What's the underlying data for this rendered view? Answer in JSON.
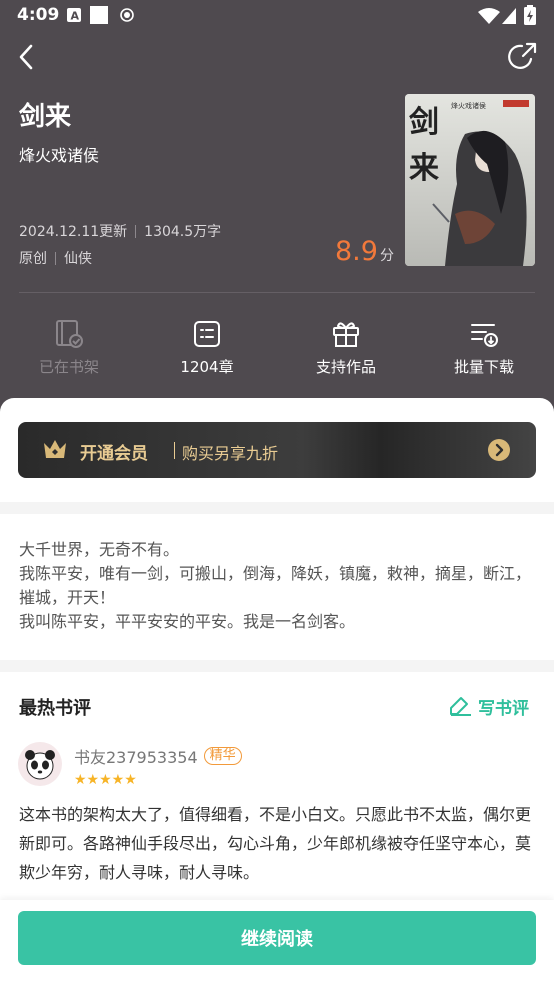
{
  "status_bar": {
    "time": "4:09"
  },
  "book": {
    "title": "剑来",
    "author": "烽火戏诸侯",
    "updated": "2024.12.11更新",
    "word_count": "1304.5万字",
    "tag_origin": "原创",
    "tag_genre": "仙侠",
    "score": "8.9",
    "score_unit": "分",
    "cover_title": "剑来",
    "cover_author": "烽火戏诸侯"
  },
  "actions": [
    {
      "label": "已在书架",
      "icon": "bookshelf-check-icon",
      "enabled": false
    },
    {
      "label": "1204章",
      "icon": "chapter-list-icon",
      "enabled": true
    },
    {
      "label": "支持作品",
      "icon": "gift-icon",
      "enabled": true
    },
    {
      "label": "批量下载",
      "icon": "batch-download-icon",
      "enabled": true
    }
  ],
  "vip": {
    "title": "开通会员",
    "subtitle": "购买另享九折"
  },
  "intro": {
    "text": "大千世界，无奇不有。\n我陈平安，唯有一剑，可搬山，倒海，降妖，镇魔，敕神，摘星，断江，摧城，开天！\n我叫陈平安，平平安安的平安。我是一名剑客。"
  },
  "reviews": {
    "heading": "最热书评",
    "write_label": "写书评",
    "items": [
      {
        "user": "书友237953354",
        "badge": "精华",
        "stars": "★★★★★",
        "text": "这本书的架构太大了，值得细看，不是小白文。只愿此书不太监，偶尔更新即可。各路神仙手段尽出，勾心斗角，少年郎机缘被夺任坚守本心，莫欺少年穷，耐人寻味，耐人寻味。"
      }
    ]
  },
  "continue_label": "继续阅读",
  "colors": {
    "header_bg": "#4f4a4f",
    "accent": "#39c3a4",
    "score": "#f2793b",
    "gold": "#e9cc93"
  }
}
